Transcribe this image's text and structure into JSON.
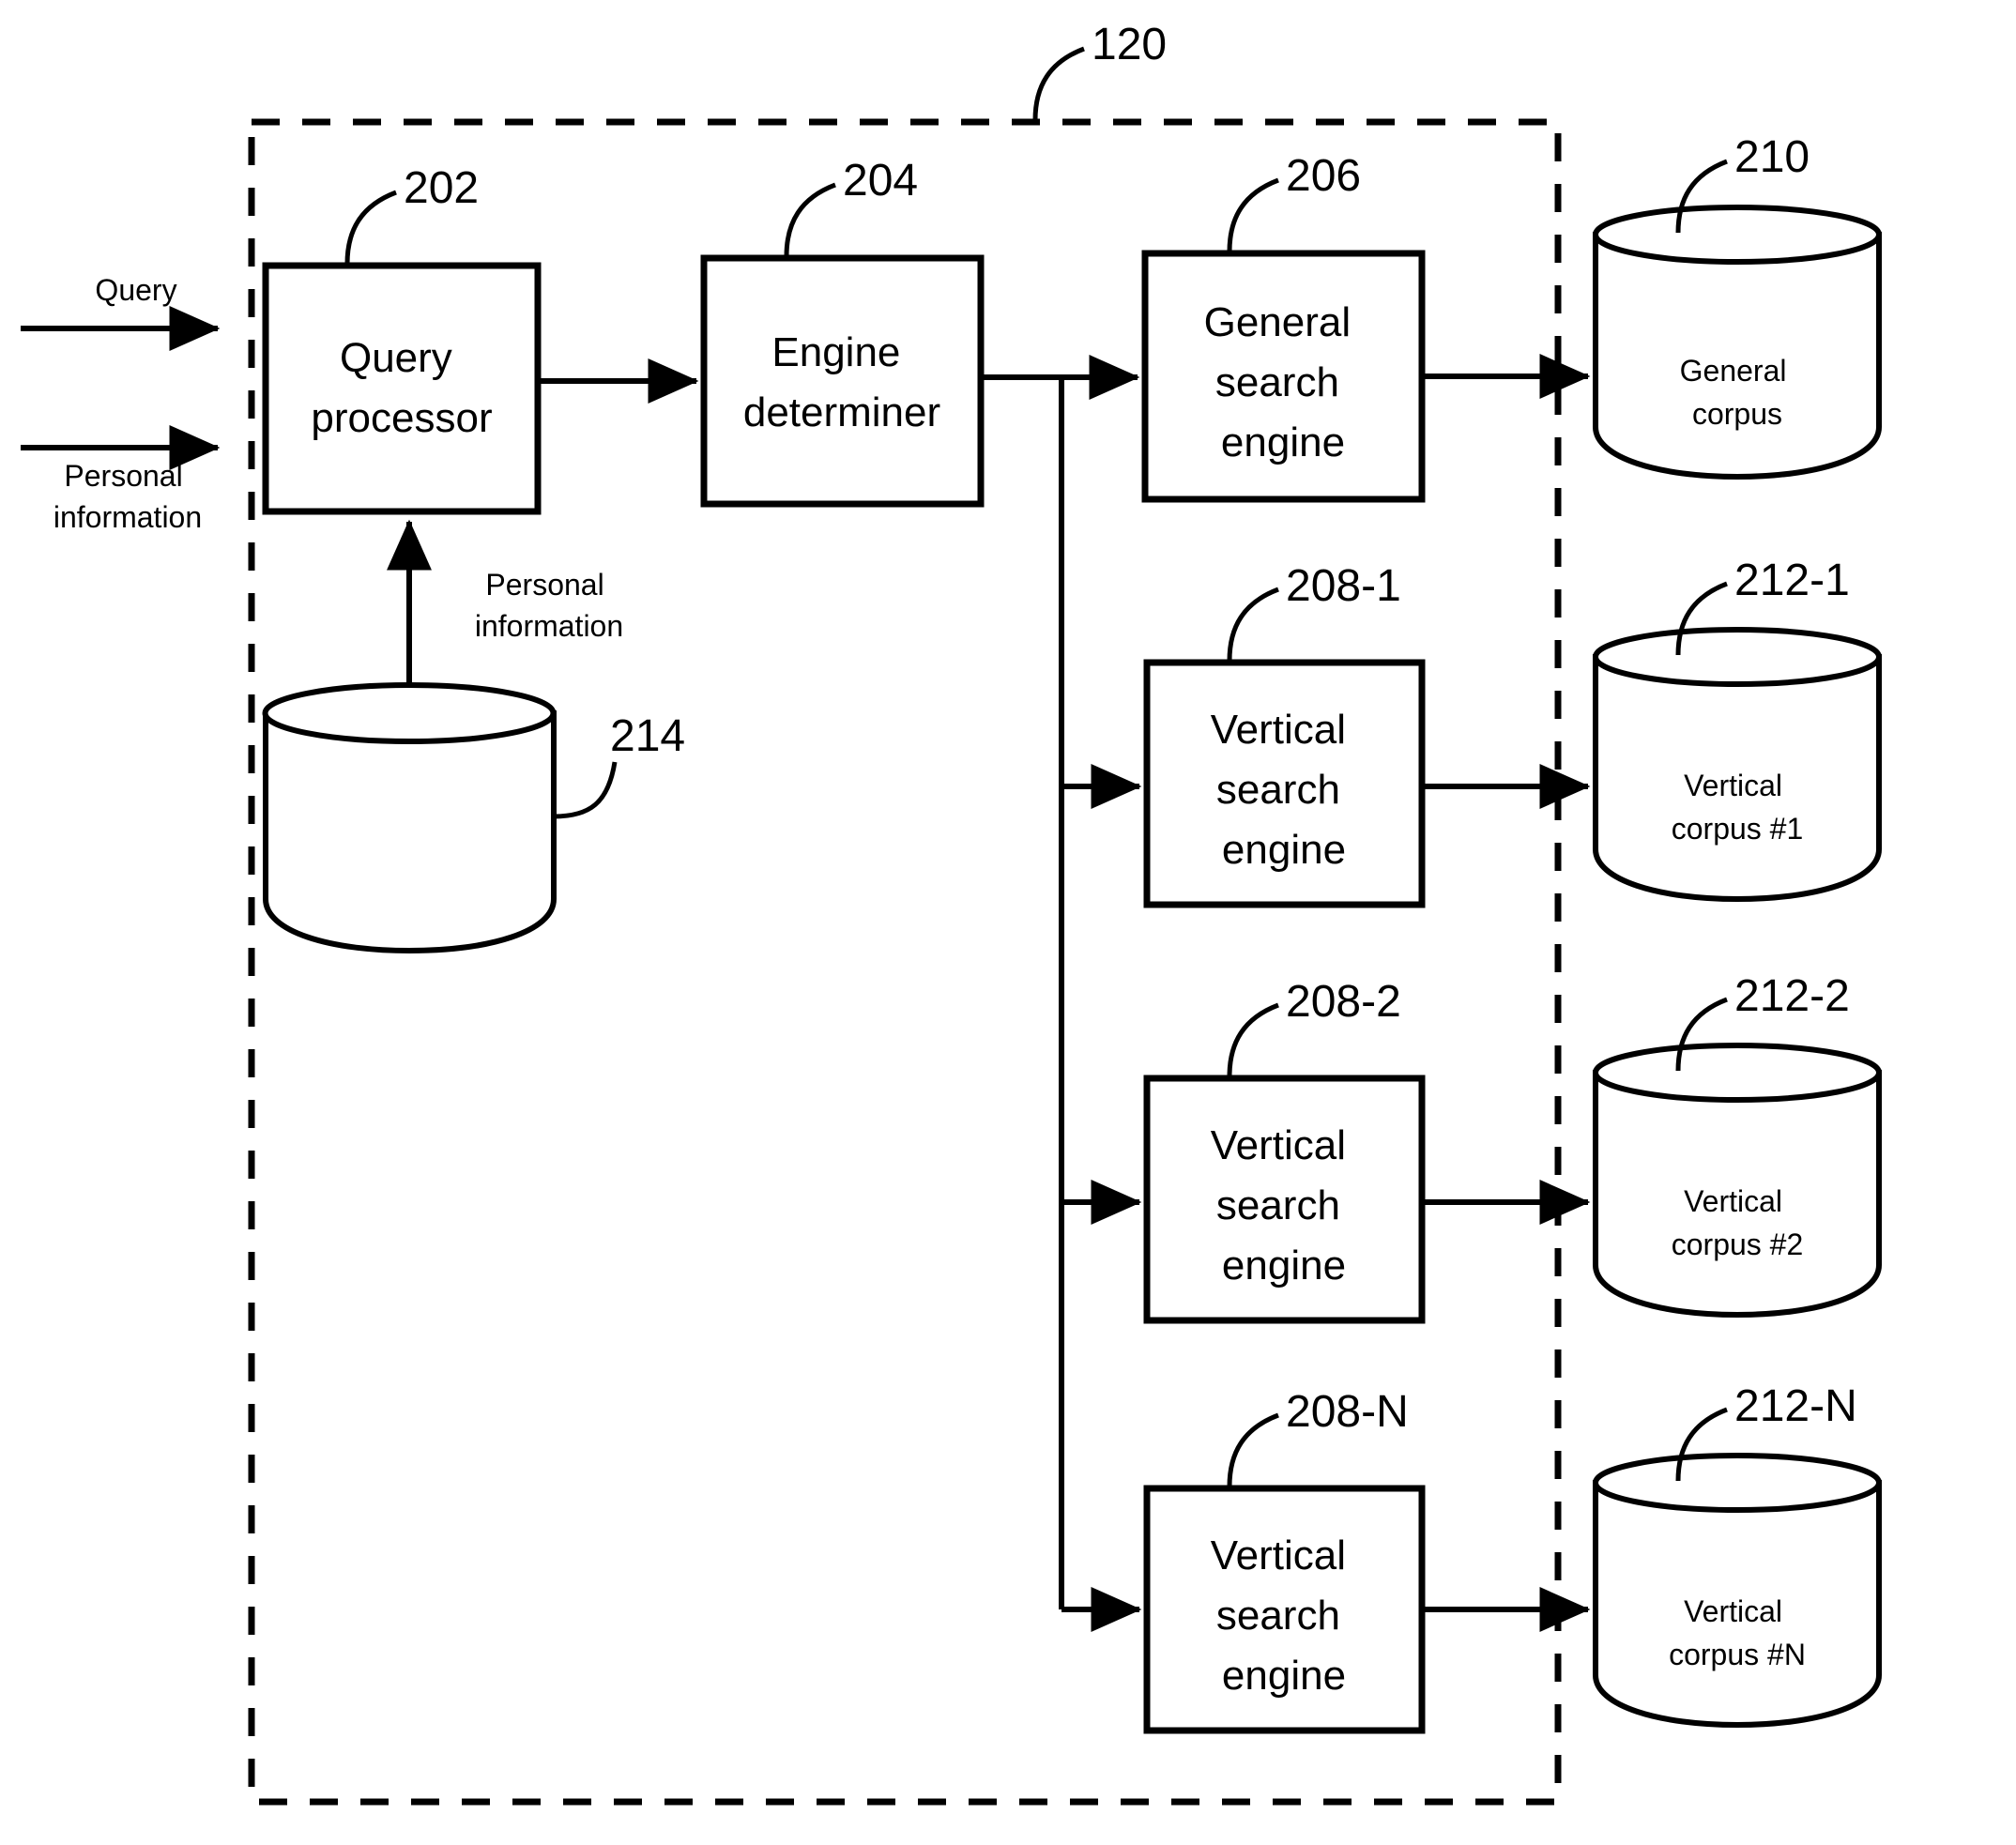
{
  "figure": {
    "system_ref": "120",
    "inputs": [
      {
        "name": "query",
        "label": "Query"
      },
      {
        "name": "personal-information",
        "label": "Personal\ninformation"
      }
    ],
    "internal_flow_label": "Personal\ninformation",
    "boxes": [
      {
        "id": "query-processor",
        "ref": "202",
        "line1": "Query",
        "line2": "processor",
        "line3": ""
      },
      {
        "id": "engine-determiner",
        "ref": "204",
        "line1": "Engine",
        "line2": "determiner",
        "line3": ""
      },
      {
        "id": "general-search-engine",
        "ref": "206",
        "line1": "General",
        "line2": "search",
        "line3": "engine"
      },
      {
        "id": "vertical-search-engine-1",
        "ref": "208-1",
        "line1": "Vertical",
        "line2": "search",
        "line3": "engine"
      },
      {
        "id": "vertical-search-engine-2",
        "ref": "208-2",
        "line1": "Vertical",
        "line2": "search",
        "line3": "engine"
      },
      {
        "id": "vertical-search-engine-n",
        "ref": "208-N",
        "line1": "Vertical",
        "line2": "search",
        "line3": "engine"
      }
    ],
    "cylinders": [
      {
        "id": "personal-information-store",
        "ref": "214",
        "line1": "",
        "line2": ""
      },
      {
        "id": "general-corpus",
        "ref": "210",
        "line1": "General",
        "line2": "corpus"
      },
      {
        "id": "vertical-corpus-1",
        "ref": "212-1",
        "line1": "Vertical",
        "line2": "corpus #1"
      },
      {
        "id": "vertical-corpus-2",
        "ref": "212-2",
        "line1": "Vertical",
        "line2": "corpus #2"
      },
      {
        "id": "vertical-corpus-n",
        "ref": "212-N",
        "line1": "Vertical",
        "line2": "corpus #N"
      }
    ],
    "colors": {
      "stroke": "#000000",
      "background": "#ffffff"
    }
  }
}
